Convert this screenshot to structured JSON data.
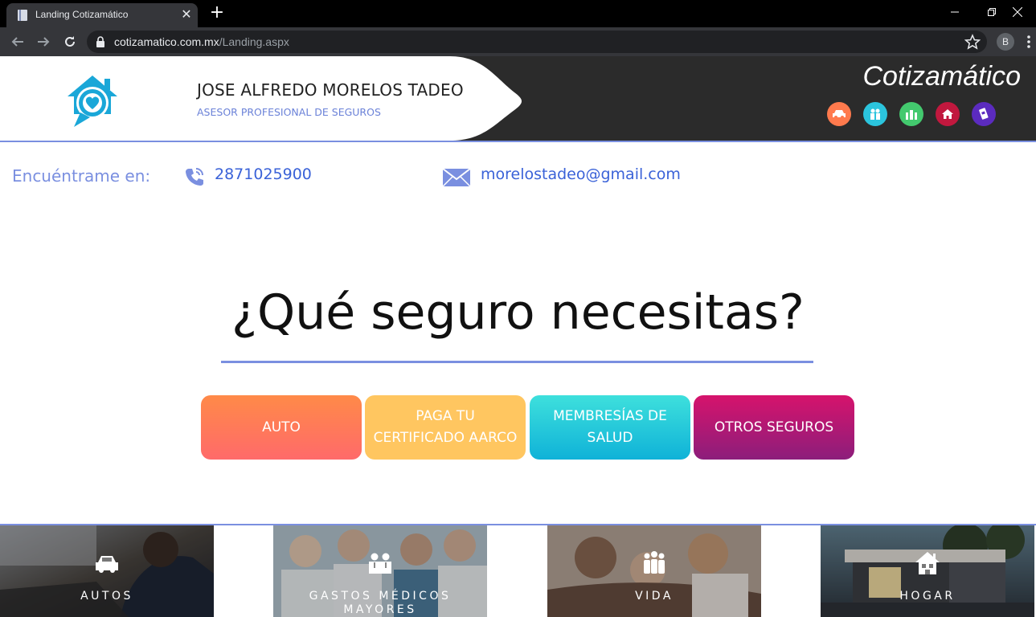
{
  "browser": {
    "tab_title": "Landing Cotizamático",
    "tab_close": "✕",
    "new_tab": "+",
    "url_domain": "cotizamatico.com.mx",
    "url_path": "/Landing.aspx",
    "profile_initial": "B"
  },
  "header": {
    "agent_name": "JOSE ALFREDO MORELOS TADEO",
    "agent_role": "ASESOR PROFESIONAL DE SEGUROS",
    "brand": "Cotizamático",
    "brand_icons": [
      {
        "icon": "car-icon",
        "color": "#ff7a4d"
      },
      {
        "icon": "family-icon",
        "color": "#2bc4dd"
      },
      {
        "icon": "life-icon",
        "color": "#43c96e"
      },
      {
        "icon": "home-icon",
        "color": "#c1183e"
      },
      {
        "icon": "other-icon",
        "color": "#5b2bbf"
      }
    ]
  },
  "contact": {
    "label": "Encuéntrame en:",
    "phone": "2871025900",
    "email": "morelostadeo@gmail.com"
  },
  "main": {
    "question": "¿Qué seguro necesitas?",
    "buttons": [
      {
        "label": "AUTO",
        "color": "#ff7a55"
      },
      {
        "label": "PAGA TU CERTIFICADO AARCO",
        "color": "#ffc660"
      },
      {
        "label": "MEMBRESÍAS DE SALUD",
        "color": "#1cc8da"
      },
      {
        "label": "OTROS SEGUROS",
        "color": "#b5196f"
      }
    ]
  },
  "tiles": [
    {
      "label": "AUTOS",
      "icon": "car-icon"
    },
    {
      "label": "GASTOS MÉDICOS MAYORES",
      "icon": "doctors-icon"
    },
    {
      "label": "VIDA",
      "icon": "family-icon"
    },
    {
      "label": "HOGAR",
      "icon": "house-icon"
    }
  ],
  "colors": {
    "accent": "#7a8fe0",
    "link": "#3a62d8",
    "header_dark": "#2b2b2b"
  }
}
